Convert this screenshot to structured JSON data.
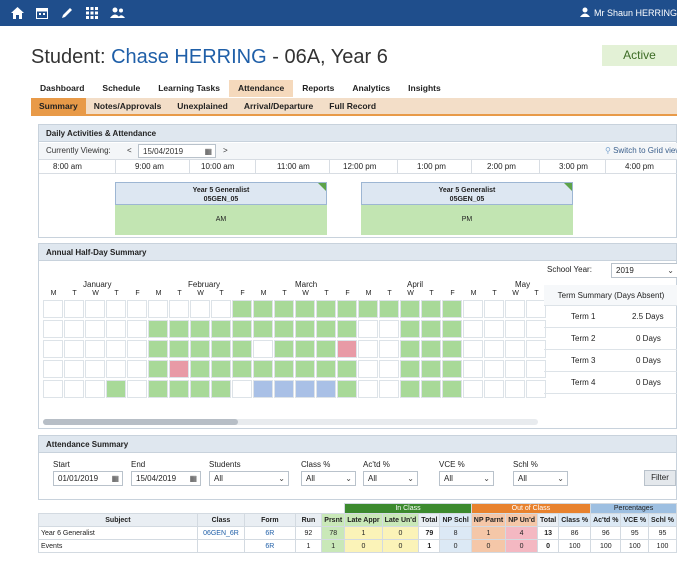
{
  "user": {
    "name": "Mr Shaun HERRING"
  },
  "student": {
    "prefix": "Student: ",
    "name": "Chase HERRING",
    "suffix": " - 06A, Year 6",
    "status": "Active"
  },
  "tabs": [
    "Dashboard",
    "Schedule",
    "Learning Tasks",
    "Attendance",
    "Reports",
    "Analytics",
    "Insights"
  ],
  "subtabs": [
    "Summary",
    "Notes/Approvals",
    "Unexplained",
    "Arrival/Departure",
    "Full Record"
  ],
  "daily": {
    "title": "Daily Activities & Attendance",
    "viewing_label": "Currently Viewing:",
    "prev": "<",
    "date": "15/04/2019",
    "next": ">",
    "grid_link": "Switch to Grid view",
    "times": [
      "8:00 am",
      "9:00 am",
      "10:00 am",
      "11:00 am",
      "12:00 pm",
      "1:00 pm",
      "2:00 pm",
      "3:00 pm",
      "4:00 pm"
    ],
    "class_am": {
      "line1": "Year 5 Generalist",
      "line2": "05GEN_05"
    },
    "class_pm": {
      "line1": "Year 5 Generalist",
      "line2": "05GEN_05"
    },
    "am": "AM",
    "pm": "PM"
  },
  "annual": {
    "title": "Annual Half-Day Summary",
    "months": [
      "January",
      "February",
      "March",
      "April",
      "May"
    ],
    "days": [
      "M",
      "T",
      "W",
      "T",
      "F",
      "M",
      "T",
      "W",
      "T",
      "F",
      "M",
      "T",
      "W",
      "T",
      "F",
      "M",
      "T",
      "W",
      "T",
      "F",
      "M",
      "T",
      "W",
      "T"
    ],
    "school_year_label": "School Year:",
    "school_year": "2019",
    "term_header": "Term Summary (Days Absent)",
    "terms": [
      {
        "name": "Term 1",
        "value": "2.5 Days"
      },
      {
        "name": "Term 2",
        "value": "0 Days"
      },
      {
        "name": "Term 3",
        "value": "0 Days"
      },
      {
        "name": "Term 4",
        "value": "0 Days"
      }
    ]
  },
  "att_summary": {
    "title": "Attendance Summary",
    "filters": {
      "start_label": "Start",
      "start": "01/01/2019",
      "end_label": "End",
      "end": "15/04/2019",
      "students_label": "Students",
      "students": "All",
      "class_label": "Class %",
      "class": "All",
      "acd_label": "Ac'td %",
      "acd": "All",
      "vce_label": "VCE %",
      "vce": "All",
      "schl_label": "Schl %",
      "schl": "All",
      "filter_btn": "Filter"
    }
  },
  "table": {
    "groups": {
      "in_class": "In Class",
      "out_class": "Out of Class",
      "percentages": "Percentages"
    },
    "headers": [
      "Subject",
      "Class",
      "Form",
      "Run",
      "Prsnt",
      "Late Appr",
      "Late Un'd",
      "Total",
      "NP Schl",
      "NP Parnt",
      "NP Un'd",
      "Total",
      "Class %",
      "Ac'td %",
      "VCE %",
      "Schl %"
    ],
    "rows": [
      [
        "Year 6 Generalist",
        "06GEN_6R",
        "6R",
        "92",
        "78",
        "1",
        "0",
        "79",
        "8",
        "1",
        "4",
        "13",
        "86",
        "96",
        "95",
        "95"
      ],
      [
        "Events",
        "",
        "6R",
        "1",
        "1",
        "0",
        "0",
        "1",
        "0",
        "0",
        "0",
        "0",
        "100",
        "100",
        "100",
        "100"
      ]
    ]
  }
}
